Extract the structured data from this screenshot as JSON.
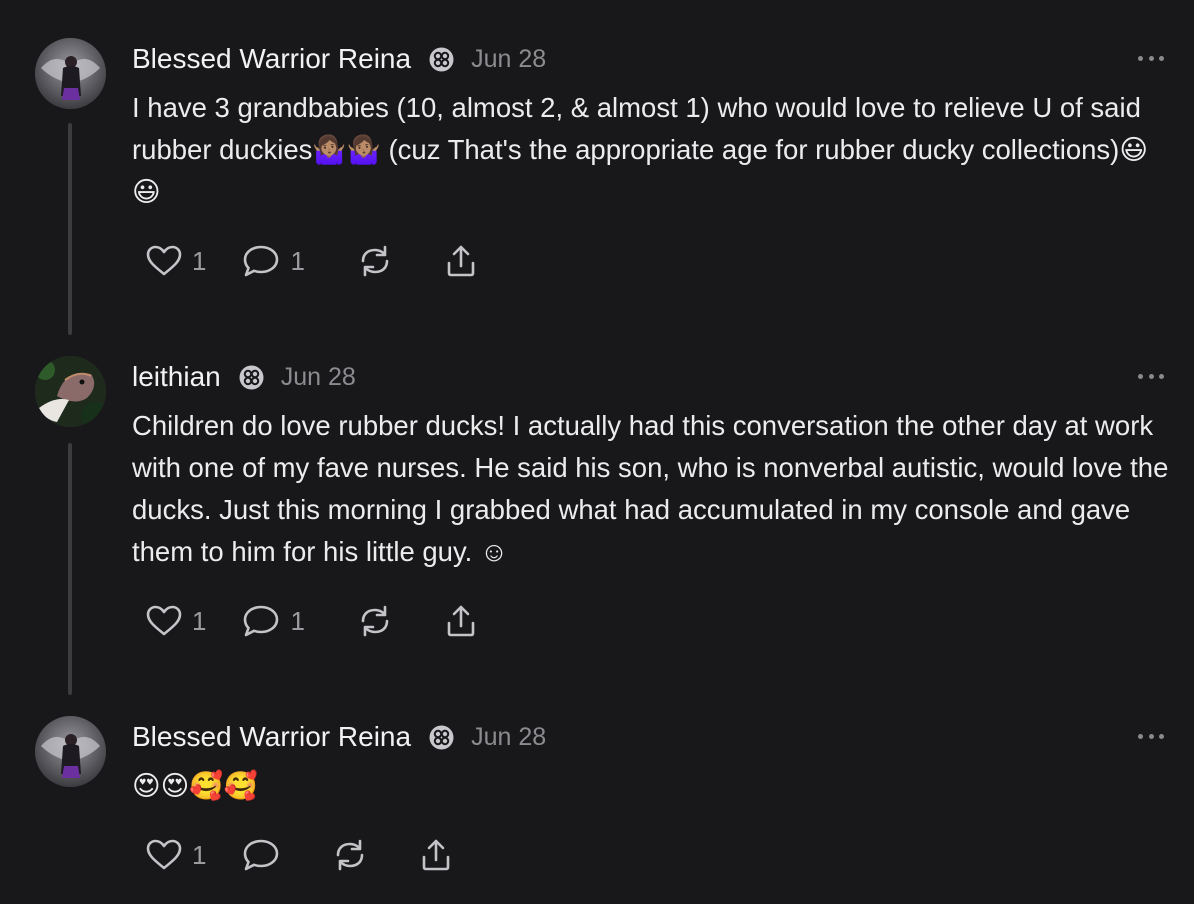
{
  "posts": [
    {
      "author": "Blessed Warrior Reina",
      "date": "Jun 28",
      "text": "I have 3 grandbabies (10, almost 2, & almost 1) who would love to relieve U of said rubber duckies🤷🏽‍♀️🤷🏽‍♀️ (cuz That's the appropriate age for rubber ducky collections)😃😃",
      "likes": "1",
      "replies": "1",
      "avatar_icon": "warrior-angel-avatar"
    },
    {
      "author": "leithian",
      "date": "Jun 28",
      "text": "Children do love rubber ducks! I actually had this conversation the other day at work with one of my fave nurses. He said his son, who is nonverbal autistic, would love the ducks. Just this morning I grabbed what had accumulated in my console and gave them to him for his little guy. ☺",
      "likes": "1",
      "replies": "1",
      "avatar_icon": "parrot-avatar"
    },
    {
      "author": "Blessed Warrior Reina",
      "date": "Jun 28",
      "text": "😍😍🥰🥰",
      "likes": "1",
      "replies": "",
      "avatar_icon": "warrior-angel-avatar"
    }
  ],
  "colors": {
    "background": "#18181a",
    "text": "#ececed",
    "muted": "#8c8c90",
    "thread_line": "#3c3c3f"
  }
}
